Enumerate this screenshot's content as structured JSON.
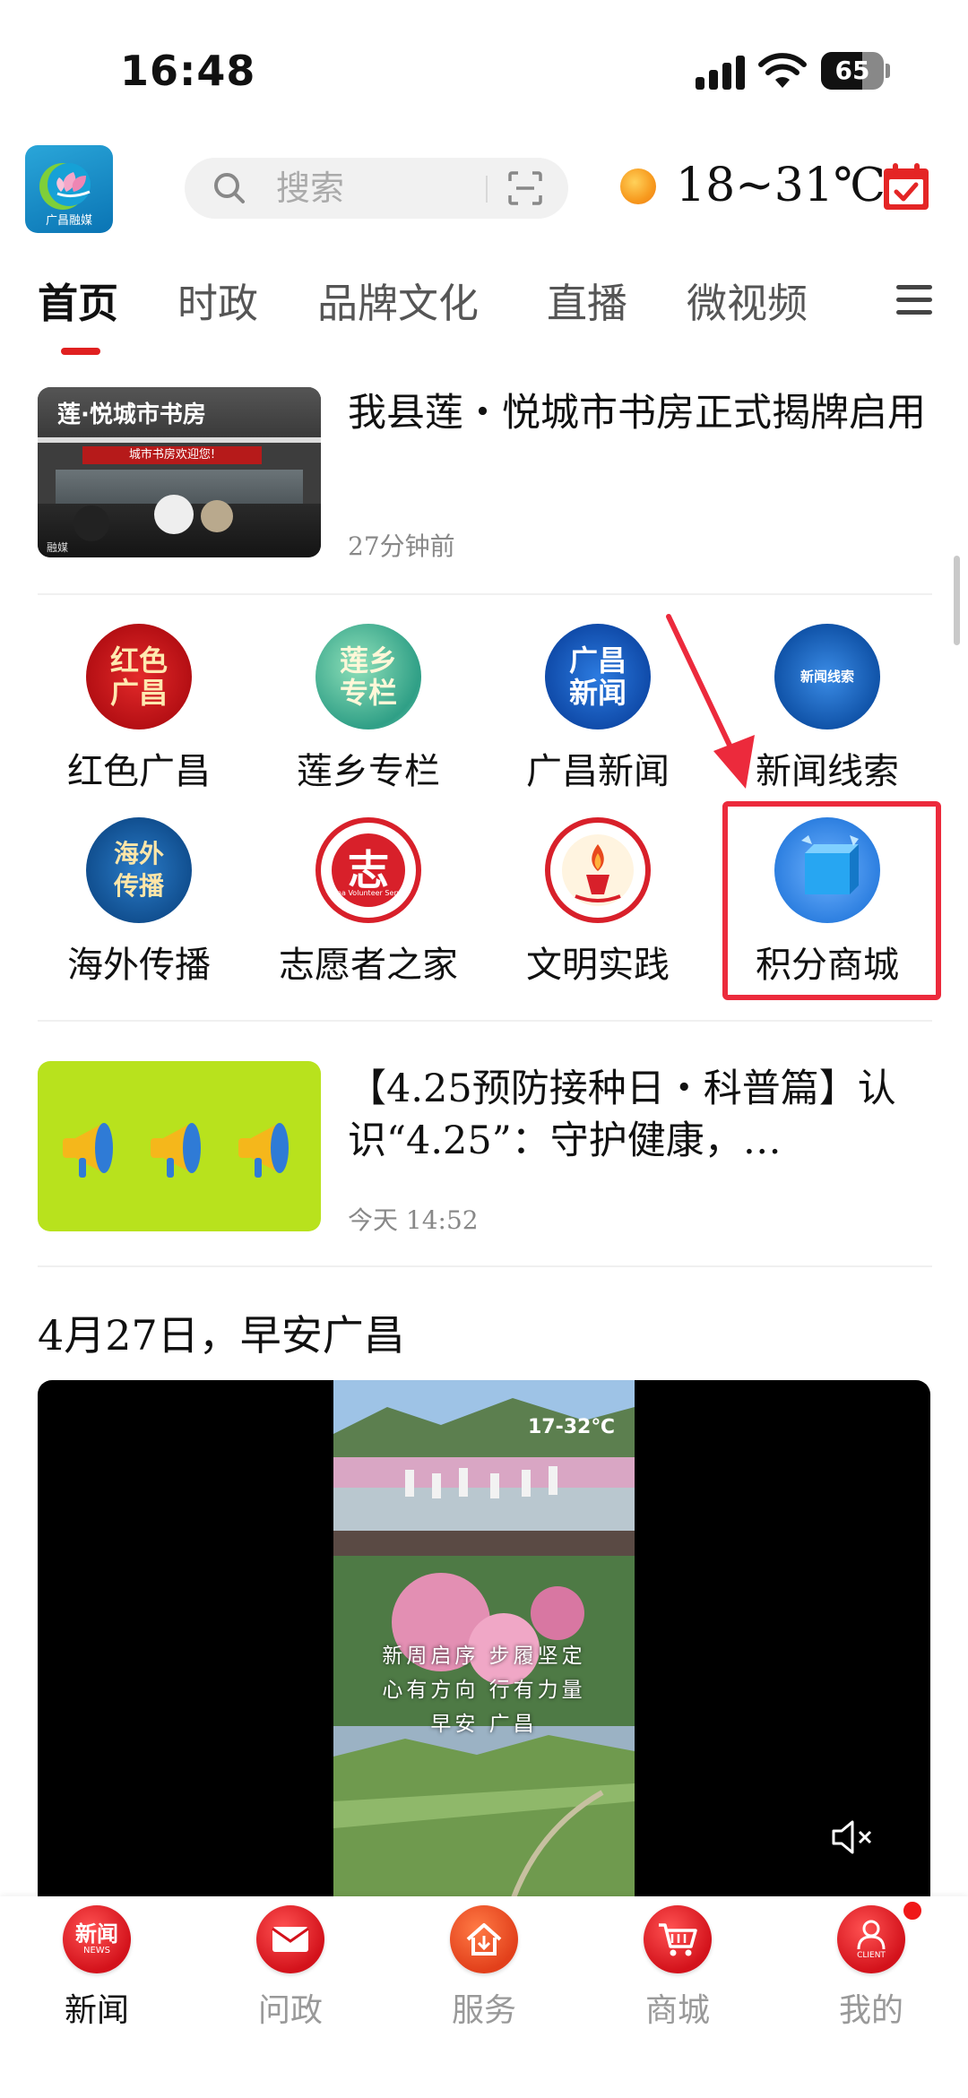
{
  "status_bar": {
    "time": "16:48",
    "battery": "65",
    "battery_level": 0.65
  },
  "header": {
    "logo_text": "广昌融媒",
    "search_placeholder": "搜索",
    "weather": "18~31℃"
  },
  "nav_tabs": [
    {
      "label": "首页",
      "active": true
    },
    {
      "label": "时政",
      "active": false
    },
    {
      "label": "品牌文化",
      "active": false
    },
    {
      "label": "直播",
      "active": false
    },
    {
      "label": "微视频",
      "active": false
    }
  ],
  "news": [
    {
      "title": "我县莲・悦城市书房正式揭牌启用",
      "time": "27分钟前",
      "thumb_sign": "莲·悦城市书房",
      "thumb_banner": "城市书房欢迎您!",
      "thumb_mark": "融媒"
    },
    {
      "title": "【4.25预防接种日・科普篇】认识“4.25”：守护健康，…",
      "time": "今天 14:52"
    }
  ],
  "icon_grid": [
    {
      "label": "红色广昌",
      "glyph": "红色\n广昌",
      "icon": "red-guangchang-icon",
      "color": "#c8161d"
    },
    {
      "label": "莲乡专栏",
      "glyph": "莲乡\n专栏",
      "icon": "lotus-column-icon",
      "color": "#3aa88a"
    },
    {
      "label": "广昌新闻",
      "glyph": "广昌\n新闻",
      "icon": "guangchang-news-icon",
      "color": "#1a5fc0"
    },
    {
      "label": "新闻线索",
      "glyph": "新闻线索",
      "icon": "news-clue-icon",
      "color": "#1a63b8"
    },
    {
      "label": "海外传播",
      "glyph": "海外\n传播",
      "icon": "overseas-icon",
      "color": "#1f6fb3"
    },
    {
      "label": "志愿者之家",
      "glyph": "志",
      "icon": "volunteer-icon",
      "color": "#d8202a"
    },
    {
      "label": "文明实践",
      "glyph": "",
      "icon": "civilization-icon",
      "color": "#d8202a"
    },
    {
      "label": "积分商城",
      "glyph": "",
      "icon": "points-mall-icon",
      "color": "#2f7de0"
    }
  ],
  "volunteer_ring_text": "China Volunteer Service",
  "section": {
    "title": "4月27日，早安广昌"
  },
  "video": {
    "temp": "17-32℃",
    "captions": [
      "新周启序 步履坚定",
      "心有方向 行有力量",
      "早安 广昌"
    ]
  },
  "bottom_nav": [
    {
      "label": "新闻",
      "icon_text": "新闻",
      "sub": "NEWS",
      "active": true
    },
    {
      "label": "问政",
      "icon_text": "",
      "sub": "",
      "active": false
    },
    {
      "label": "服务",
      "icon_text": "",
      "sub": "",
      "active": false
    },
    {
      "label": "商城",
      "icon_text": "",
      "sub": "",
      "active": false
    },
    {
      "label": "我的",
      "icon_text": "",
      "sub": "CLIENT",
      "active": false
    }
  ],
  "colors": {
    "accent": "#e02020",
    "highlight": "#ec2a3c"
  }
}
